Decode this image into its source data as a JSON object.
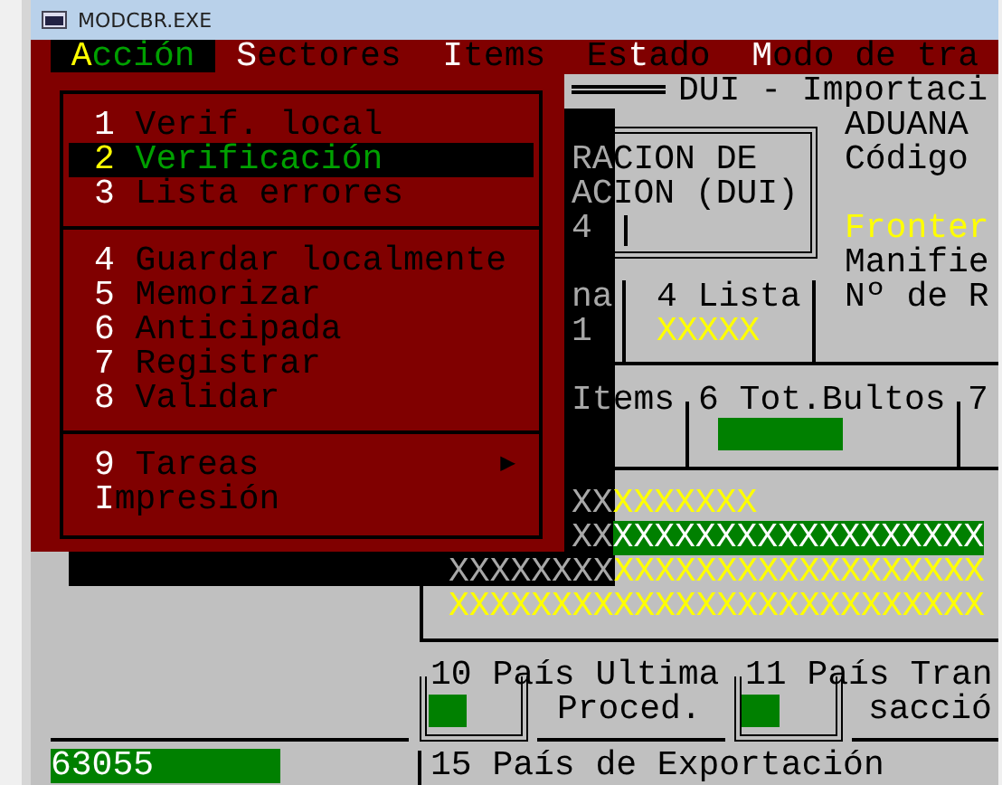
{
  "window": {
    "title": "MODCBR.EXE"
  },
  "menu_bar": [
    {
      "hotkey": "A",
      "suffix": "cción",
      "selected": true
    },
    {
      "hotkey": "S",
      "suffix": "ectores",
      "selected": false
    },
    {
      "hotkey": "I",
      "suffix": "tems",
      "selected": false
    },
    {
      "prefix": "Es",
      "hotkey": "t",
      "suffix": "ado",
      "selected": false
    },
    {
      "hotkey": "M",
      "suffix": "odo de tra",
      "selected": false
    }
  ],
  "menu": {
    "groups": [
      {
        "items": [
          {
            "kind": "numbered",
            "key": "1",
            "label": "Verif. local",
            "selected": false
          },
          {
            "kind": "numbered",
            "key": "2",
            "label": "Verificación",
            "selected": true
          },
          {
            "kind": "numbered",
            "key": "3",
            "label": "Lista errores",
            "selected": false
          }
        ]
      },
      {
        "items": [
          {
            "kind": "numbered",
            "key": "4",
            "label": "Guardar localmente",
            "selected": false
          },
          {
            "kind": "numbered",
            "key": "5",
            "label": "Memorizar",
            "selected": false
          },
          {
            "kind": "numbered",
            "key": "6",
            "label": "Anticipada",
            "selected": false
          },
          {
            "kind": "numbered",
            "key": "7",
            "label": "Registrar",
            "selected": false
          },
          {
            "kind": "numbered",
            "key": "8",
            "label": "Validar",
            "selected": false
          }
        ]
      },
      {
        "items": [
          {
            "kind": "numbered",
            "key": "9",
            "label": "Tareas",
            "arrow": "▶",
            "selected": false
          },
          {
            "kind": "lettered",
            "key": "I",
            "label": "mpresión",
            "selected": false
          }
        ]
      }
    ]
  },
  "form": {
    "title": "DUI - Importaci",
    "declaration": {
      "lines": [
        "RACION DE",
        "ACION (DUI)"
      ],
      "value": "4"
    },
    "customs": [
      "ADUANA",
      "Código"
    ],
    "frontier": "Fronter",
    "manifest": "Manifie",
    "registry": "Nº de R",
    "column_1": {
      "label": "na",
      "value": "1"
    },
    "list": {
      "label": "4 Lista",
      "value": "XXXXX"
    },
    "items_label": "Items",
    "packages_label": "6 Tot.Bultos",
    "column_7": "7",
    "filler_rows": [
      {
        "segments": [
          "XX",
          "XXXXXXX"
        ]
      },
      {
        "segments": [
          "XX",
          "XXXXXXXXXXXXXXXXXX"
        ]
      },
      {
        "segments": [
          "XXXXXXXX",
          "XXXXXXXXXXXXXXXXXX"
        ]
      },
      {
        "segments": [
          "XXXXXXXXXXXXXXXXXXXXXXXXXX"
        ]
      }
    ],
    "origin": {
      "label": "10 País Ultima",
      "label_2": "Proced."
    },
    "transit": {
      "label": "11 País Tran",
      "label_2": "sacció"
    },
    "code_value": "63055",
    "export_country": "15 País de Exportación"
  }
}
